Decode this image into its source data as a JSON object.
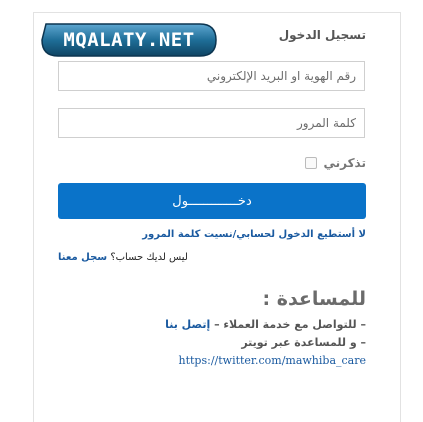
{
  "logo": {
    "text": "MQALATY.NET"
  },
  "login": {
    "title": "تسجيل الدخول",
    "id_placeholder": "رقم الهوية او البريد الإلكتروني",
    "password_placeholder": "كلمة المرور",
    "remember_label": "تذكرني",
    "submit_label": "دخـــــــــــــول",
    "forgot_link": "لا أستطيع الدخول لحسابي/نسيت كلمة المرور",
    "no_account_text": "ليس لديك حساب؟",
    "register_link": "سجل معنا"
  },
  "help": {
    "title": "للمساعدة :",
    "line1_prefix": "– للتواصل مع خدمة العملاء – ",
    "line1_link": "إتصل بنا",
    "line2": "– و للمساعدة عبر تويتر",
    "twitter_url": "https://twitter.com/mawhiba_care"
  },
  "colors": {
    "primary_button": "#0a73c9",
    "link": "#1a5aa0",
    "logo_bg": "#1f6e98"
  }
}
